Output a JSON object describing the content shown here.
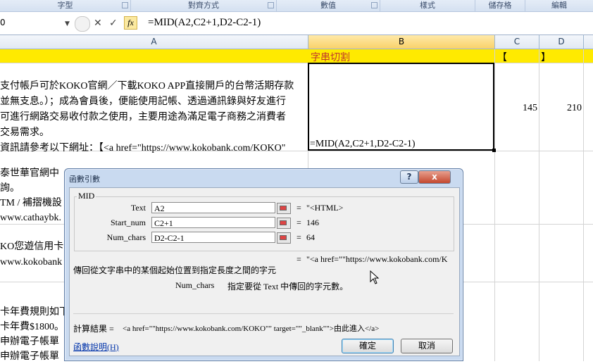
{
  "ribbon_groups": [
    {
      "label": "字型"
    },
    {
      "label": "對齊方式"
    },
    {
      "label": "數值"
    },
    {
      "label": "樣式"
    },
    {
      "label": "儲存格"
    },
    {
      "label": "編輯"
    }
  ],
  "formula_bar": {
    "namebox": "0",
    "fx_label": "fx",
    "formula": "=MID(A2,C2+1,D2-C2-1)"
  },
  "columns": [
    "A",
    "B",
    "C",
    "D"
  ],
  "cells": {
    "B1": "字串切割",
    "C1": "【",
    "D1": "】",
    "A2_lines": [
      "支付帳戶可於KOKO官網／下載KOKO APP直接開戶的台幣活期存款",
      "並無支息。）；成為會員後，便能使用記帳、透過通訊錄與好友進行",
      "可進行網路交易收付款之使用，主要用途為滿足電子商務之消費者",
      "交易需求。",
      "資訊請參考以下網址：【<a href=\"https://www.kokobank.com/KOKO\""
    ],
    "B2": "=MID(A2,C2+1,D2-C2-1)",
    "C2": "145",
    "D2": "210",
    "A3_lines": [
      "泰世華官網中",
      "詢。",
      "TM / 補摺機設",
      "www.cathaybk."
    ],
    "A4_lines": [
      "KO您遊信用卡",
      "www.kokobank"
    ],
    "A5_lines": [
      "卡年費規則如下",
      "卡年費$1800。",
      "申辦電子帳單",
      "申辦電子帳單"
    ]
  },
  "dialog": {
    "title": "函數引數",
    "func_name": "MID",
    "args": [
      {
        "label": "Text",
        "value": "A2",
        "result": "\"<HTML>"
      },
      {
        "label": "Start_num",
        "value": "C2+1",
        "result": "146"
      },
      {
        "label": "Num_chars",
        "value": "D2-C2-1",
        "result": "64"
      }
    ],
    "eq": "=",
    "overall_result": "\"<a href=\"\"https://www.kokobank.com/KC",
    "description": "傳回從文字串中的某個起始位置到指定長度之間的字元",
    "arg_help_name": "Num_chars",
    "arg_help_text": "指定要從 Text 中傳回的字元數。",
    "calc_label": "計算結果 =",
    "calc_value": "<a href=\"\"https://www.kokobank.com/KOKO\"\" target=\"\"_blank\"\">由此進入</a>",
    "help_link": "函數說明(H)",
    "ok_label": "確定",
    "cancel_label": "取消",
    "help_btn": "?",
    "close_btn": "x"
  },
  "colors": {
    "header_yellow": "#ffea00",
    "header_text_red": "#c0392b",
    "dialog_frame": "#c9daf0"
  }
}
